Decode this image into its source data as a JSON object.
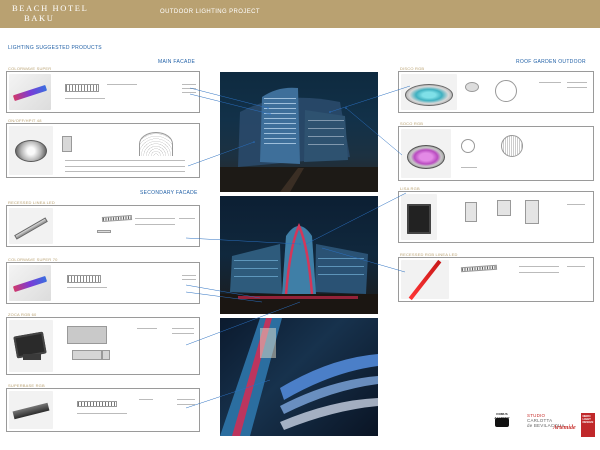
{
  "header": {
    "brand_line1": "BEACH HOTEL",
    "brand_line2": "BAKU",
    "project_title": "OUTDOOR LIGHTING PROJECT"
  },
  "sections": {
    "suggested_products": "LIGHTING SUGGESTED PRODUCTS",
    "main_facade": "MAIN FACADE",
    "secondary_facade": "SECONDARY FACADE",
    "roof_garden": "ROOF GARDEN OUTDOOR"
  },
  "products_left": [
    {
      "label": "COLORWAVE SUPER"
    },
    {
      "label": "ON/OFF/HPIT 48"
    },
    {
      "label": "RECESSED LINEA LED"
    },
    {
      "label": "COLORWAVE SUPER 70"
    },
    {
      "label": "ZOCA RGB 60"
    },
    {
      "label": "SUPERBASE RGB"
    }
  ],
  "products_right": [
    {
      "label": "DISCO RGB"
    },
    {
      "label": "SOCO RGB"
    },
    {
      "label": "LISA RGB"
    },
    {
      "label": "RECESSED RGB LINEA LED"
    }
  ],
  "footer": {
    "logo_left": "DOMUS\nACADEMY\nMILANO",
    "studio_line1": "STUDIO",
    "studio_line2": "CARLOTTA",
    "studio_line3": "de BEVILACQUA",
    "artemide": "Artemide",
    "redbox_line1": "NERO",
    "redbox_line2": "LIGHT",
    "redbox_line3": "DESIGN"
  },
  "colors": {
    "header_bg": "#b9a171",
    "section_blue": "#1f5fa6",
    "product_gold": "#b9a171",
    "leader_line": "#2a6fc0"
  }
}
